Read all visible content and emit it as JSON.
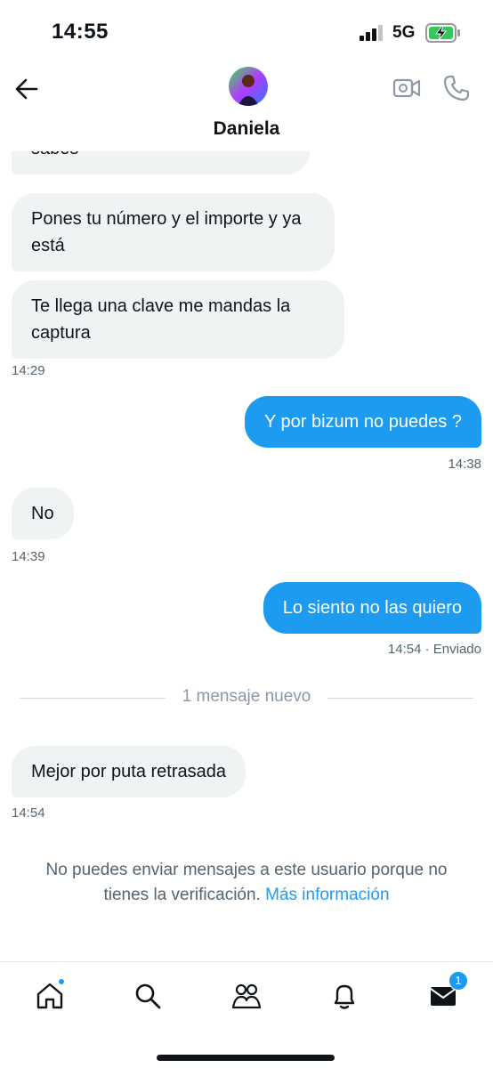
{
  "status_bar": {
    "time": "14:55",
    "network": "5G"
  },
  "header": {
    "contact_name": "Daniela"
  },
  "messages": [
    {
      "dir": "in",
      "text": "sabes"
    },
    {
      "dir": "in",
      "text": "Pones tu número y el importe y ya está"
    },
    {
      "dir": "in",
      "text": "Te llega una clave me mandas la captura",
      "time": "14:29"
    },
    {
      "dir": "out",
      "text": "Y por bizum no puedes ?",
      "time": "14:38"
    },
    {
      "dir": "in",
      "text": "No",
      "time": "14:39"
    },
    {
      "dir": "out",
      "text": "Lo siento no las quiero",
      "time": "14:54",
      "status": "· Enviado"
    },
    {
      "dir": "in",
      "text": "Mejor por puta retrasada",
      "time": "14:54"
    }
  ],
  "divider": {
    "text": "1 mensaje nuevo"
  },
  "notice": {
    "line1": "No puedes enviar mensajes a este usuario porque no",
    "line2": "tienes la verificación.",
    "link": "Más información"
  },
  "nav": {
    "items": [
      "home-icon",
      "search-icon",
      "communities-icon",
      "notifications-icon",
      "messages-icon"
    ],
    "messages_badge": "1"
  },
  "colors": {
    "accent": "#1d9bf0",
    "incoming_bubble": "#eff3f4",
    "text": "#0f1419",
    "muted": "#536471"
  }
}
